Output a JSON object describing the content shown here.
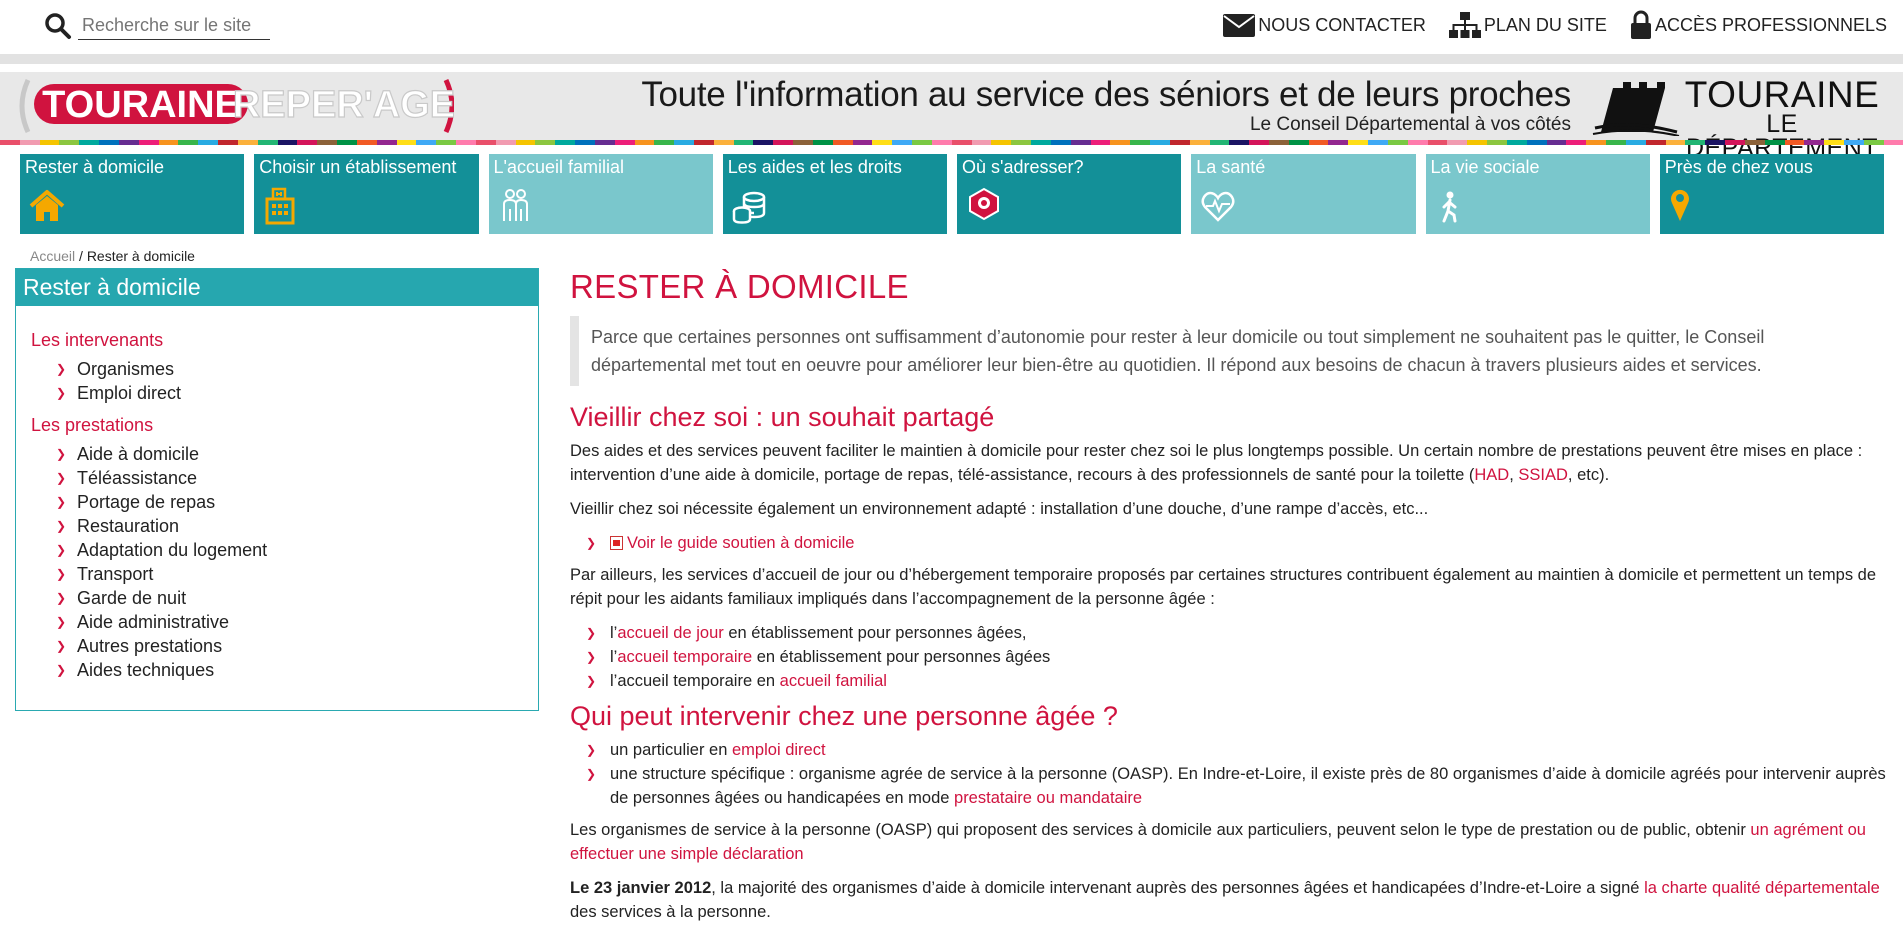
{
  "search": {
    "placeholder": "Recherche sur le site"
  },
  "toplinks": {
    "contact": "NOUS CONTACTER",
    "plan": "PLAN DU SITE",
    "pro": "ACCÈS PROFESSIONNELS"
  },
  "banner": {
    "logo_left": "TOURAINE",
    "logo_right": "REPER'AGE",
    "tagline": "Toute l'information au service des séniors et de leurs proches",
    "subtagline": "Le Conseil Départemental à vos côtés",
    "dept_line1": "TOURAINE",
    "dept_line2": "LE DÉPARTEMENT"
  },
  "colors": {
    "accent": "#d0133f",
    "teal_dark": "#139098",
    "teal_light": "#7ac7cc",
    "stripes": [
      "#e94f6a",
      "#f19bb0",
      "#f5c400",
      "#8cc63f",
      "#00a99d",
      "#0071bc",
      "#662d91",
      "#ed1e79",
      "#f7931e",
      "#39b54a",
      "#29abe2",
      "#c1272d",
      "#fbb03b",
      "#22b573",
      "#1b1464",
      "#d4145a",
      "#8c6239",
      "#009245",
      "#f15a24",
      "#93278f",
      "#ffde17",
      "#3fa9f5",
      "#7ac943",
      "#ff7bac"
    ]
  },
  "nav": [
    {
      "label": "Rester à domicile",
      "icon": "home-icon",
      "style": "dark"
    },
    {
      "label": "Choisir un établissement",
      "icon": "building-icon",
      "style": "dark"
    },
    {
      "label": "L'accueil familial",
      "icon": "family-icon",
      "style": "light"
    },
    {
      "label": "Les aides et les droits",
      "icon": "coins-icon",
      "style": "dark"
    },
    {
      "label": "Où s'adresser?",
      "icon": "location-badge-icon",
      "style": "dark"
    },
    {
      "label": "La santé",
      "icon": "heart-pulse-icon",
      "style": "light"
    },
    {
      "label": "La vie sociale",
      "icon": "walking-person-icon",
      "style": "light"
    },
    {
      "label": "Près de chez vous",
      "icon": "map-pin-icon",
      "style": "dark"
    }
  ],
  "breadcrumb": {
    "home": "Accueil",
    "sep": "/",
    "current": "Rester à domicile"
  },
  "sidebar": {
    "title": "Rester à domicile",
    "section1": "Les intervenants",
    "items1": [
      "Organismes",
      "Emploi direct"
    ],
    "section2": "Les prestations",
    "items2": [
      "Aide à domicile",
      "Téléassistance",
      "Portage de repas",
      "Restauration",
      "Adaptation du logement",
      "Transport",
      "Garde de nuit",
      "Aide administrative",
      "Autres prestations",
      "Aides techniques"
    ]
  },
  "content": {
    "title": "RESTER À DOMICILE",
    "intro": "Parce que certaines personnes ont suffisamment d’autonomie pour rester à leur domicile ou tout simplement ne souhaitent pas le quitter, le Conseil départemental met tout en oeuvre pour améliorer leur bien-être au quotidien. Il répond aux besoins de chacun à travers plusieurs aides et services.",
    "h2_1": "Vieillir chez soi : un souhait partagé",
    "p1": "Des aides et des services peuvent faciliter le maintien à domicile pour rester chez soi le plus longtemps possible. Un certain nombre de prestations peuvent être mises en place : intervention d’une aide à domicile, portage de repas, télé-assistance, recours à des professionnels de santé pour la toilette (",
    "p1_link1": "HAD",
    "p1_comma": ", ",
    "p1_link2": "SSIAD",
    "p1_end": ", etc).",
    "p2": "Vieillir chez soi nécessite également un environnement adapté : installation d’une douche, d’une rampe d’accès, etc...",
    "guide_link": "Voir le guide soutien à domicile",
    "p3": "Par ailleurs, les services d’accueil de jour ou d’hébergement temporaire proposés par certaines structures contribuent également au maintien à domicile et permettent un temps de répit pour les aidants familiaux impliqués dans l’accompagnement de la personne âgée :",
    "l1_pre": "l’",
    "l1_link": "accueil de jour",
    "l1_post": " en établissement pour personnes âgées,",
    "l2_pre": "l’",
    "l2_link": "accueil temporaire",
    "l2_post": " en établissement pour personnes âgées",
    "l3_pre": "l’accueil temporaire en ",
    "l3_link": "accueil familial",
    "h2_2": "Qui peut intervenir chez une personne âgée ?",
    "m1_pre": "un particulier en ",
    "m1_link": "emploi direct",
    "m2_pre": "une structure spécifique : organisme agrée de service à la personne (OASP). En Indre-et-Loire, il existe près de 80 organismes d’aide à domicile agréés pour intervenir auprès de personnes âgées ou handicapées en mode ",
    "m2_link": "prestataire ou mandataire",
    "p4": "Les organismes de service à la personne (OASP) qui proposent des services à domicile aux particuliers, peuvent  selon le type de prestation ou de public, obtenir ",
    "p4_link": "un agrément ou effectuer une simple déclaration",
    "p5_bold": "Le 23 janvier 2012",
    "p5": ", la majorité des organismes d’aide à domicile intervenant auprès des personnes âgées et handicapées d’Indre-et-Loire a signé ",
    "p5_link": "la charte qualité départementale",
    "p5_end": " des services à la personne."
  }
}
